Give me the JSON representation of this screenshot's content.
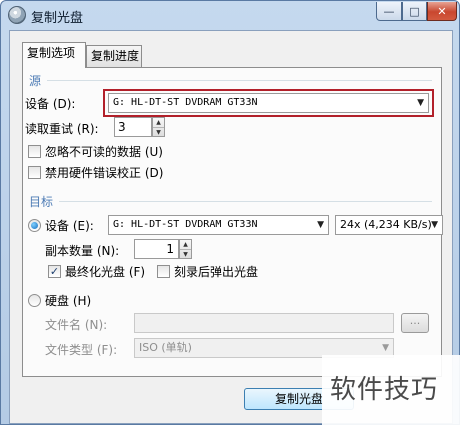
{
  "window": {
    "title": "复制光盘",
    "icon": "disc-icon",
    "minimize_glyph": "—",
    "maximize_glyph": "□",
    "close_glyph": "✕"
  },
  "tabs": [
    {
      "label": "复制选项",
      "active": true
    },
    {
      "label": "复制进度",
      "active": false
    }
  ],
  "source": {
    "title": "源",
    "device_label": "设备 (D):",
    "device_value": "G: HL-DT-ST DVDRAM GT33N",
    "retry_label": "读取重试 (R):",
    "retry_value": "3",
    "ignore_unreadable_label": "忽略不可读的数据 (U)",
    "ignore_unreadable_checked": false,
    "disable_ecc_label": "禁用硬件错误校正 (D)",
    "disable_ecc_checked": false
  },
  "target": {
    "title": "目标",
    "device_radio_label": "设备 (E):",
    "device_radio_checked": true,
    "device_value": "G: HL-DT-ST DVDRAM GT33N",
    "speed_value": "24x (4,234 KB/s)",
    "copies_label": "副本数量 (N):",
    "copies_value": "1",
    "finalize_label": "最终化光盘 (F)",
    "finalize_checked": true,
    "eject_label": "刻录后弹出光盘",
    "eject_checked": false,
    "disk_radio_label": "硬盘 (H)",
    "disk_radio_checked": false,
    "filename_label": "文件名 (N):",
    "filename_value": "",
    "browse_label": "...",
    "filetype_label": "文件类型 (F):",
    "filetype_value": "ISO (单轨)"
  },
  "footer": {
    "copy_button_label": "复制光盘"
  },
  "watermark": {
    "text": "软件技巧"
  },
  "colors": {
    "highlight_border": "#b2202a",
    "group_title": "#4e7cb5",
    "close_button": "#c9472f"
  }
}
